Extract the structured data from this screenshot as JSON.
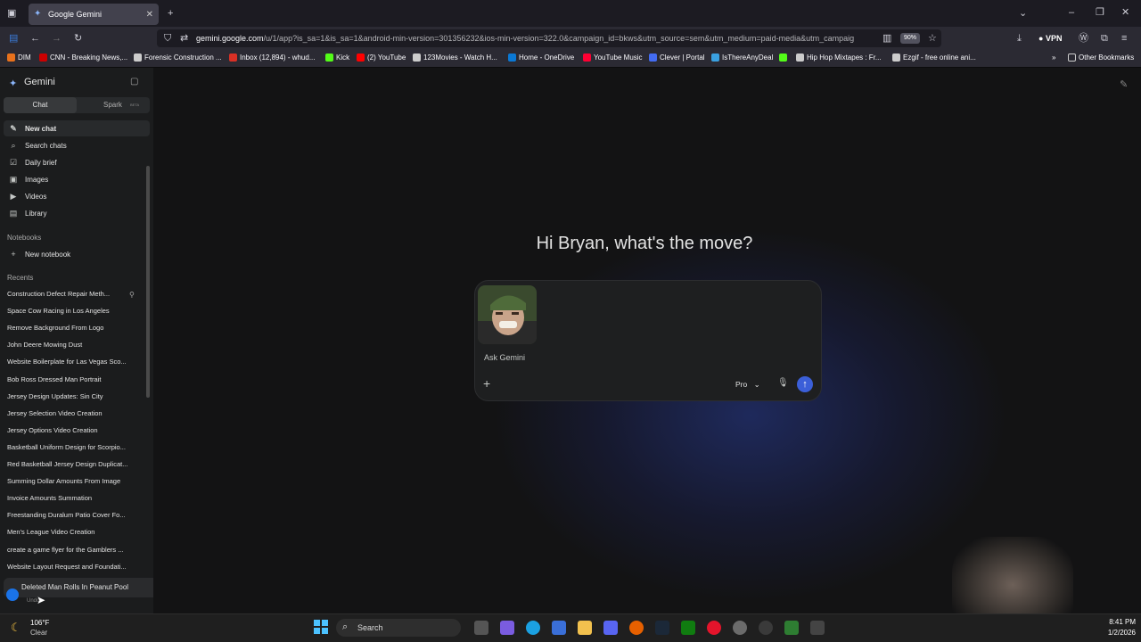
{
  "browser": {
    "tab_title": "Google Gemini",
    "url_domain": "gemini.google.com",
    "url_rest": "/u/1/app?is_sa=1&is_sa=1&android-min-version=301356232&ios-min-version=322.0&campaign_id=bkws&utm_source=sem&utm_medium=paid-media&utm_campaig",
    "zoom": "90%",
    "vpn_label": "VPN",
    "bookmarks": [
      {
        "label": "DIM",
        "color": "#e8711c"
      },
      {
        "label": "CNN - Breaking News,...",
        "color": "#cc0000"
      },
      {
        "label": "Forensic Construction ...",
        "color": "#cccccc"
      },
      {
        "label": "Inbox (12,894) - whud...",
        "color": "#d93025"
      },
      {
        "label": "Kick",
        "color": "#53fc18"
      },
      {
        "label": "(2) YouTube",
        "color": "#ff0000"
      },
      {
        "label": "123Movies - Watch H...",
        "color": "#cccccc"
      },
      {
        "label": "Home - OneDrive",
        "color": "#0a78d4"
      },
      {
        "label": "YouTube Music",
        "color": "#ff0033"
      },
      {
        "label": "Clever | Portal",
        "color": "#436cf2"
      },
      {
        "label": "IsThereAnyDeal",
        "color": "#3aa0e0"
      },
      {
        "label": "",
        "color": "#53fc18"
      },
      {
        "label": "Hip Hop Mixtapes : Fr...",
        "color": "#cccccc"
      },
      {
        "label": "Ezgif - free online ani...",
        "color": "#cccccc"
      }
    ],
    "other_bookmarks": "Other Bookmarks"
  },
  "sidebar": {
    "app_name": "Gemini",
    "tabs": [
      {
        "label": "Chat"
      },
      {
        "label": "Spark"
      }
    ],
    "beta_badge": "BETA",
    "nav": [
      {
        "label": "New chat",
        "icon": "edit-icon"
      },
      {
        "label": "Search chats",
        "icon": "search-icon"
      },
      {
        "label": "Daily brief",
        "icon": "calendar-check-icon"
      },
      {
        "label": "Images",
        "icon": "image-icon"
      },
      {
        "label": "Videos",
        "icon": "video-icon"
      },
      {
        "label": "Library",
        "icon": "library-icon"
      }
    ],
    "notebooks_header": "Notebooks",
    "new_notebook": "New notebook",
    "recents_header": "Recents",
    "recents": [
      "Construction Defect Repair Meth...",
      "Space Cow Racing in Los Angeles",
      "Remove Background From Logo",
      "John Deere Mowing Dust",
      "Website Boilerplate for Las Vegas Sco...",
      "Bob Ross Dressed Man Portrait",
      "Jersey Design Updates: Sin City",
      "Jersey Selection Video Creation",
      "Jersey Options Video Creation",
      "Basketball Uniform Design for Scorpio...",
      "Red Basketball Jersey Design Duplicat...",
      "Summing Dollar Amounts From Image",
      "Invoice Amounts Summation",
      "Freestanding Duralum Patio Cover Fo...",
      "Men's League Video Creation",
      "create a game flyer for the Gamblers ...",
      "Website Layout Request and Foundati..."
    ],
    "toast": "Deleted Man Rolls In Peanut Pool",
    "toast_sub": "Undo"
  },
  "main": {
    "greeting": "Hi Bryan, what's the move?",
    "input_placeholder": "Ask Gemini",
    "model": "Pro"
  },
  "taskbar": {
    "temperature": "106°F",
    "condition": "Clear",
    "search_label": "Search",
    "time": "8:41 PM",
    "date": "1/2/2026"
  }
}
